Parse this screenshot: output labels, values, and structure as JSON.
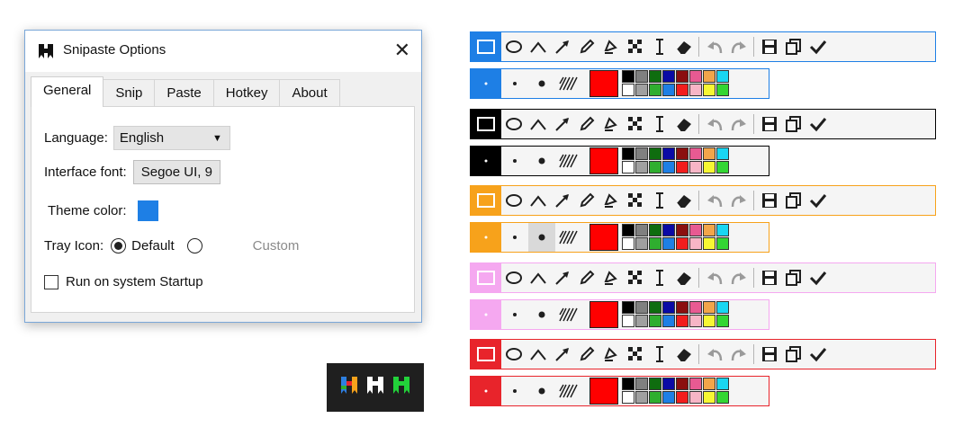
{
  "dialog": {
    "title": "Snipaste Options",
    "close_glyph": "✕",
    "tabs": [
      "General",
      "Snip",
      "Paste",
      "Hotkey",
      "About"
    ],
    "language_label": "Language:",
    "language_value": "English",
    "font_label": "Interface font:",
    "font_value": "Segoe UI, 9",
    "theme_label": "Theme color:",
    "theme_color": "#1e7fe5",
    "tray_label": "Tray Icon:",
    "tray_default": "Default",
    "tray_custom": "Custom",
    "startup_label": "Run on system Startup"
  },
  "tray_icons": [
    "multicolor-logo-icon",
    "white-logo-icon",
    "green-logo-icon"
  ],
  "toolbar_themes": [
    {
      "name": "blue",
      "color": "#1e7fe5"
    },
    {
      "name": "black",
      "color": "#000000"
    },
    {
      "name": "orange",
      "color": "#f7a21b"
    },
    {
      "name": "pink",
      "color": "#f5a8f0"
    },
    {
      "name": "red",
      "color": "#e8242b"
    }
  ],
  "toolbar_icons": [
    "rectangle-icon",
    "ellipse-icon",
    "polyline-icon",
    "arrow-icon",
    "pencil-icon",
    "marker-icon",
    "mosaic-icon",
    "text-icon",
    "eraser-icon",
    "undo-icon",
    "redo-icon",
    "save-icon",
    "copy-icon",
    "done-icon"
  ],
  "current_color": "#ff0000",
  "palette": [
    "#000000",
    "#808080",
    "#0f6d0f",
    "#0a0aa5",
    "#8b0f0f",
    "#e85a92",
    "#f2a54a",
    "#19d6f2",
    "#ffffff",
    "#a0a0a0",
    "#2fae2f",
    "#1e7fe5",
    "#f21d1d",
    "#f7b5c6",
    "#f7f733",
    "#33d633"
  ]
}
